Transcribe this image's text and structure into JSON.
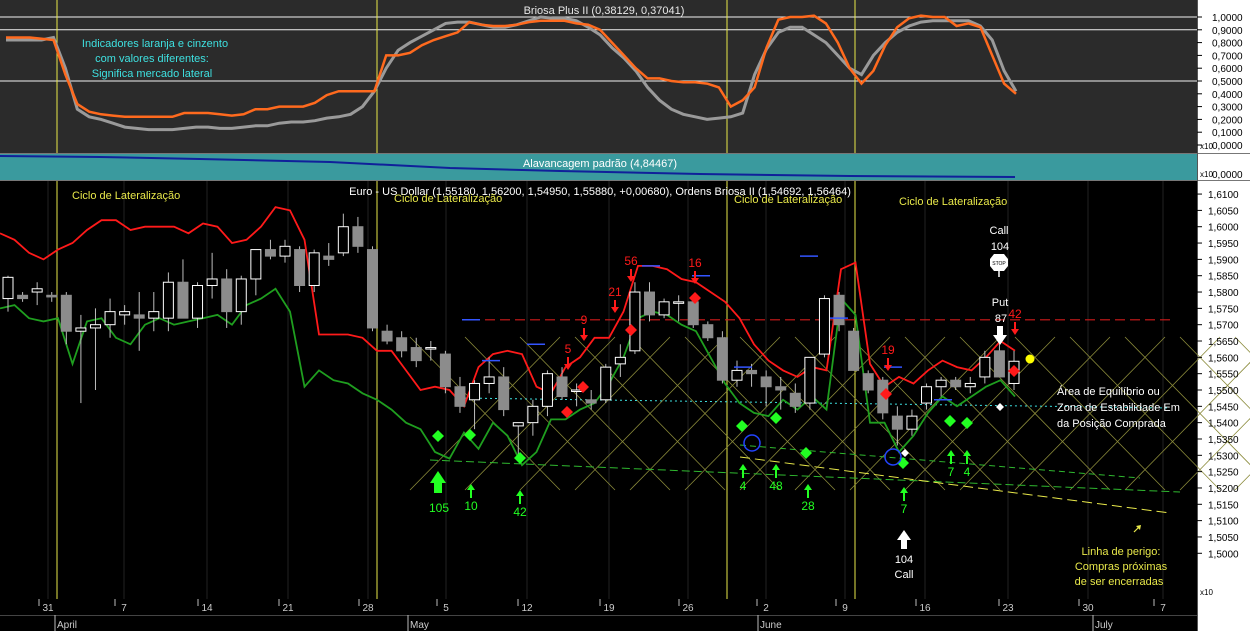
{
  "colors": {
    "background": "#000000",
    "osc_bg": "#2b2b2b",
    "lev_bg": "#3a9a9e",
    "axis_bg": "#ffffff",
    "orange": "#ff6a1e",
    "gray": "#9a9a9a",
    "red": "#ff1a1a",
    "green": "#1f9e1f",
    "bright_green": "#22ff22",
    "yellow": "#e8e84a",
    "cyan": "#3ee0e0",
    "white": "#ffffff",
    "candle_up": "#ffffff",
    "candle_down": "#8c8c8c"
  },
  "oscillator": {
    "title": "Briosa Plus II (0,38129, 0,37041)",
    "note": [
      "Indicadores laranja e cinzento",
      "com valores diferentes:",
      "Significa mercado lateral"
    ],
    "levels": [
      0.9,
      0.5,
      1.0
    ],
    "ticks": [
      "1,0000",
      "0,9000",
      "0,8000",
      "0,7000",
      "0,6000",
      "0,5000",
      "0,4000",
      "0,3000",
      "0,2000",
      "0,1000",
      "0,0000"
    ],
    "ylim": [
      0,
      1.05
    ],
    "scale_label": "x10"
  },
  "leverage": {
    "title": "Alavancagem padrão (4,84467)",
    "tick": "0,0000",
    "scale_label": "x10"
  },
  "price": {
    "title": "Euro - US Dollar (1,55180, 1,56200, 1,54950, 1,55880, +0,00680), Ordens Briosa II (1,54692, 1,56464)",
    "ylim": [
      1.486,
      1.614
    ],
    "ticks": [
      "1,6100",
      "1,6050",
      "1,6000",
      "1,5950",
      "1,5900",
      "1,5850",
      "1,5800",
      "1,5750",
      "1,5700",
      "1,5650",
      "1,5600",
      "1,5550",
      "1,5500",
      "1,5450",
      "1,5400",
      "1,5350",
      "1,5300",
      "1,5250",
      "1,5200",
      "1,5150",
      "1,5100",
      "1,5050",
      "1,5000"
    ],
    "scale_label": "x10",
    "cycle_labels": [
      "Ciclo de Lateralização",
      "Ciclo de Lateralização",
      "Ciclo de Lateralização",
      "Ciclo de Lateralização"
    ],
    "annotations": {
      "call_top": [
        "Call",
        "104"
      ],
      "stop": "STOP",
      "put": [
        "Put",
        "87"
      ],
      "call_bottom": [
        "104",
        "Call"
      ],
      "equilibrium": [
        "Área de Equilíbrio ou",
        "Zona de Estabilidade Em",
        "da Posição Comprada"
      ],
      "danger": [
        "Linha de perigo:",
        "Compras próximas",
        "de ser encerradas"
      ]
    },
    "buy_labels": [
      "105",
      "10",
      "42",
      "4",
      "48",
      "28",
      "7",
      "7",
      "4"
    ],
    "sell_labels": [
      "5",
      "9",
      "21",
      "56",
      "16",
      "19",
      "42"
    ],
    "resistance": 1.5715,
    "cyan_level": 1.555
  },
  "xaxis": {
    "day_ticks": [
      "31",
      "7",
      "14",
      "21",
      "28",
      "5",
      "12",
      "19",
      "26",
      "2",
      "9",
      "16",
      "23",
      "30",
      "7"
    ],
    "months": [
      "April",
      "May",
      "June",
      "July"
    ]
  },
  "chart_data": {
    "type": "candlestick",
    "title": "Euro - US Dollar (1,55180, 1,56200, 1,54950, 1,55880, +0,00680), Ordens Briosa II (1,54692, 1,56464)",
    "candles": [
      {
        "o": 1.578,
        "h": 1.585,
        "l": 1.574,
        "c": 1.5845
      },
      {
        "o": 1.579,
        "h": 1.58,
        "l": 1.577,
        "c": 1.578
      },
      {
        "o": 1.58,
        "h": 1.583,
        "l": 1.576,
        "c": 1.581
      },
      {
        "o": 1.579,
        "h": 1.58,
        "l": 1.577,
        "c": 1.5785
      },
      {
        "o": 1.579,
        "h": 1.58,
        "l": 1.564,
        "c": 1.568
      },
      {
        "o": 1.568,
        "h": 1.573,
        "l": 1.546,
        "c": 1.569
      },
      {
        "o": 1.569,
        "h": 1.575,
        "l": 1.55,
        "c": 1.57
      },
      {
        "o": 1.57,
        "h": 1.578,
        "l": 1.566,
        "c": 1.574
      },
      {
        "o": 1.573,
        "h": 1.576,
        "l": 1.57,
        "c": 1.574
      },
      {
        "o": 1.573,
        "h": 1.58,
        "l": 1.562,
        "c": 1.572
      },
      {
        "o": 1.572,
        "h": 1.58,
        "l": 1.568,
        "c": 1.574
      },
      {
        "o": 1.572,
        "h": 1.586,
        "l": 1.568,
        "c": 1.583
      },
      {
        "o": 1.583,
        "h": 1.59,
        "l": 1.572,
        "c": 1.572
      },
      {
        "o": 1.572,
        "h": 1.583,
        "l": 1.569,
        "c": 1.582
      },
      {
        "o": 1.582,
        "h": 1.592,
        "l": 1.578,
        "c": 1.584
      },
      {
        "o": 1.584,
        "h": 1.587,
        "l": 1.569,
        "c": 1.574
      },
      {
        "o": 1.574,
        "h": 1.585,
        "l": 1.57,
        "c": 1.584
      },
      {
        "o": 1.584,
        "h": 1.593,
        "l": 1.579,
        "c": 1.593
      },
      {
        "o": 1.593,
        "h": 1.596,
        "l": 1.59,
        "c": 1.591
      },
      {
        "o": 1.591,
        "h": 1.596,
        "l": 1.589,
        "c": 1.594
      },
      {
        "o": 1.593,
        "h": 1.594,
        "l": 1.58,
        "c": 1.582
      },
      {
        "o": 1.582,
        "h": 1.593,
        "l": 1.58,
        "c": 1.592
      },
      {
        "o": 1.591,
        "h": 1.595,
        "l": 1.588,
        "c": 1.59
      },
      {
        "o": 1.592,
        "h": 1.604,
        "l": 1.591,
        "c": 1.6
      },
      {
        "o": 1.6,
        "h": 1.603,
        "l": 1.592,
        "c": 1.594
      },
      {
        "o": 1.593,
        "h": 1.594,
        "l": 1.568,
        "c": 1.569
      },
      {
        "o": 1.568,
        "h": 1.57,
        "l": 1.564,
        "c": 1.565
      },
      {
        "o": 1.566,
        "h": 1.568,
        "l": 1.56,
        "c": 1.562
      },
      {
        "o": 1.563,
        "h": 1.566,
        "l": 1.557,
        "c": 1.559
      },
      {
        "o": 1.563,
        "h": 1.565,
        "l": 1.559,
        "c": 1.563
      },
      {
        "o": 1.561,
        "h": 1.562,
        "l": 1.549,
        "c": 1.551
      },
      {
        "o": 1.551,
        "h": 1.554,
        "l": 1.543,
        "c": 1.545
      },
      {
        "o": 1.547,
        "h": 1.553,
        "l": 1.538,
        "c": 1.552
      },
      {
        "o": 1.552,
        "h": 1.56,
        "l": 1.549,
        "c": 1.554
      },
      {
        "o": 1.554,
        "h": 1.557,
        "l": 1.542,
        "c": 1.544
      },
      {
        "o": 1.539,
        "h": 1.54,
        "l": 1.529,
        "c": 1.54
      },
      {
        "o": 1.54,
        "h": 1.547,
        "l": 1.536,
        "c": 1.545
      },
      {
        "o": 1.545,
        "h": 1.556,
        "l": 1.542,
        "c": 1.555
      },
      {
        "o": 1.554,
        "h": 1.557,
        "l": 1.547,
        "c": 1.548
      },
      {
        "o": 1.55,
        "h": 1.552,
        "l": 1.545,
        "c": 1.55
      },
      {
        "o": 1.547,
        "h": 1.55,
        "l": 1.544,
        "c": 1.546
      },
      {
        "o": 1.547,
        "h": 1.558,
        "l": 1.546,
        "c": 1.557
      },
      {
        "o": 1.558,
        "h": 1.564,
        "l": 1.554,
        "c": 1.56
      },
      {
        "o": 1.562,
        "h": 1.583,
        "l": 1.561,
        "c": 1.58
      },
      {
        "o": 1.58,
        "h": 1.583,
        "l": 1.571,
        "c": 1.573
      },
      {
        "o": 1.573,
        "h": 1.578,
        "l": 1.572,
        "c": 1.577
      },
      {
        "o": 1.577,
        "h": 1.579,
        "l": 1.571,
        "c": 1.577
      },
      {
        "o": 1.577,
        "h": 1.579,
        "l": 1.569,
        "c": 1.57
      },
      {
        "o": 1.57,
        "h": 1.571,
        "l": 1.565,
        "c": 1.566
      },
      {
        "o": 1.566,
        "h": 1.568,
        "l": 1.552,
        "c": 1.553
      },
      {
        "o": 1.553,
        "h": 1.559,
        "l": 1.551,
        "c": 1.556
      },
      {
        "o": 1.556,
        "h": 1.558,
        "l": 1.551,
        "c": 1.555
      },
      {
        "o": 1.554,
        "h": 1.556,
        "l": 1.545,
        "c": 1.551
      },
      {
        "o": 1.551,
        "h": 1.554,
        "l": 1.544,
        "c": 1.55
      },
      {
        "o": 1.549,
        "h": 1.552,
        "l": 1.543,
        "c": 1.545
      },
      {
        "o": 1.546,
        "h": 1.56,
        "l": 1.544,
        "c": 1.56
      },
      {
        "o": 1.561,
        "h": 1.579,
        "l": 1.56,
        "c": 1.578
      },
      {
        "o": 1.579,
        "h": 1.58,
        "l": 1.568,
        "c": 1.57
      },
      {
        "o": 1.568,
        "h": 1.569,
        "l": 1.556,
        "c": 1.556
      },
      {
        "o": 1.555,
        "h": 1.556,
        "l": 1.549,
        "c": 1.55
      },
      {
        "o": 1.553,
        "h": 1.554,
        "l": 1.541,
        "c": 1.543
      },
      {
        "o": 1.542,
        "h": 1.545,
        "l": 1.533,
        "c": 1.538
      },
      {
        "o": 1.538,
        "h": 1.544,
        "l": 1.536,
        "c": 1.542
      },
      {
        "o": 1.546,
        "h": 1.552,
        "l": 1.544,
        "c": 1.551
      },
      {
        "o": 1.551,
        "h": 1.554,
        "l": 1.548,
        "c": 1.553
      },
      {
        "o": 1.553,
        "h": 1.554,
        "l": 1.55,
        "c": 1.551
      },
      {
        "o": 1.551,
        "h": 1.554,
        "l": 1.549,
        "c": 1.552
      },
      {
        "o": 1.554,
        "h": 1.562,
        "l": 1.552,
        "c": 1.56
      },
      {
        "o": 1.562,
        "h": 1.564,
        "l": 1.554,
        "c": 1.554
      },
      {
        "o": 1.552,
        "h": 1.562,
        "l": 1.55,
        "c": 1.5588
      }
    ],
    "red_line": [
      1.598,
      1.596,
      1.592,
      1.59,
      1.593,
      1.595,
      1.599,
      1.602,
      1.602,
      1.599,
      1.6,
      1.6,
      1.6,
      1.598,
      1.601,
      1.6,
      1.595,
      1.596,
      1.6,
      1.606,
      1.605,
      1.596,
      1.567,
      1.567,
      1.567,
      1.566,
      1.562,
      1.562,
      1.556,
      1.55,
      1.551,
      1.55,
      1.545,
      1.557,
      1.561,
      1.562,
      1.561,
      1.551,
      1.549,
      1.557,
      1.56,
      1.566,
      1.566,
      1.574,
      1.588,
      1.588,
      1.587,
      1.584,
      1.583,
      1.58,
      1.577,
      1.572,
      1.564,
      1.559,
      1.556,
      1.554,
      1.557,
      1.556,
      1.587,
      1.589,
      1.558,
      1.551,
      1.554,
      1.552,
      1.556,
      1.559,
      1.557,
      1.556,
      1.56,
      1.565,
      1.562
    ],
    "green_line": [
      1.575,
      1.576,
      1.572,
      1.571,
      1.572,
      1.558,
      1.571,
      1.572,
      1.566,
      1.564,
      1.57,
      1.572,
      1.57,
      1.571,
      1.572,
      1.573,
      1.57,
      1.576,
      1.578,
      1.581,
      1.574,
      1.551,
      1.556,
      1.553,
      1.552,
      1.549,
      1.547,
      1.544,
      1.54,
      1.538,
      1.531,
      1.529,
      1.537,
      1.532,
      1.54,
      1.536,
      1.527,
      1.531,
      1.541,
      1.541,
      1.544,
      1.546,
      1.552,
      1.56,
      1.572,
      1.574,
      1.573,
      1.57,
      1.568,
      1.56,
      1.552,
      1.546,
      1.543,
      1.542,
      1.547,
      1.544,
      1.548,
      1.544,
      1.578,
      1.573,
      1.54,
      1.54,
      1.531,
      1.536,
      1.543,
      1.548,
      1.545,
      1.548,
      1.551,
      1.553,
      1.548
    ]
  },
  "osc_data": {
    "orange": [
      0.84,
      0.84,
      0.84,
      0.83,
      0.82,
      0.55,
      0.32,
      0.26,
      0.24,
      0.23,
      0.22,
      0.22,
      0.22,
      0.22,
      0.22,
      0.25,
      0.25,
      0.25,
      0.24,
      0.23,
      0.24,
      0.28,
      0.28,
      0.3,
      0.3,
      0.3,
      0.33,
      0.39,
      0.42,
      0.42,
      0.42,
      0.42,
      0.7,
      0.7,
      0.72,
      0.78,
      0.82,
      0.85,
      0.88,
      0.96,
      0.94,
      0.93,
      0.93,
      0.94,
      0.96,
      0.97,
      0.97,
      0.97,
      0.95,
      0.94,
      0.9,
      0.8,
      0.7,
      0.6,
      0.52,
      0.52,
      0.5,
      0.49,
      0.49,
      0.48,
      0.45,
      0.3,
      0.35,
      0.45,
      0.76,
      0.98,
      1.0,
      1.0,
      1.01,
      0.95,
      0.8,
      0.6,
      0.48,
      0.58,
      0.78,
      0.92,
      0.99,
      1.01,
      1.0,
      1.0,
      0.93,
      0.95,
      0.92,
      0.7,
      0.48,
      0.4
    ],
    "gray": [
      0.82,
      0.82,
      0.82,
      0.82,
      0.84,
      0.6,
      0.28,
      0.22,
      0.2,
      0.17,
      0.14,
      0.13,
      0.12,
      0.12,
      0.12,
      0.13,
      0.14,
      0.14,
      0.13,
      0.13,
      0.14,
      0.15,
      0.15,
      0.17,
      0.18,
      0.18,
      0.19,
      0.21,
      0.22,
      0.24,
      0.3,
      0.42,
      0.6,
      0.74,
      0.8,
      0.85,
      0.9,
      0.95,
      0.96,
      0.96,
      0.94,
      0.92,
      0.92,
      0.94,
      0.97,
      1.0,
      0.99,
      0.99,
      0.97,
      0.92,
      0.86,
      0.76,
      0.68,
      0.58,
      0.45,
      0.35,
      0.28,
      0.24,
      0.22,
      0.2,
      0.21,
      0.22,
      0.25,
      0.55,
      0.75,
      0.88,
      0.92,
      0.92,
      0.86,
      0.8,
      0.7,
      0.6,
      0.55,
      0.7,
      0.8,
      0.88,
      0.93,
      0.96,
      0.97,
      0.97,
      0.97,
      0.97,
      0.93,
      0.82,
      0.58,
      0.42
    ]
  }
}
